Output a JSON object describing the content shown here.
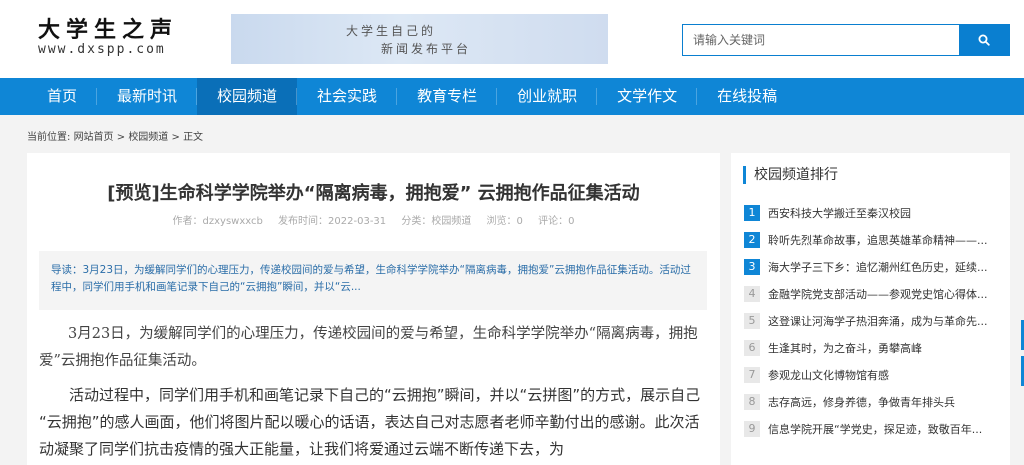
{
  "site": {
    "logo_cn": "大学生之声",
    "logo_en": "www.dxspp.com",
    "banner_line1": "大学生自己的",
    "banner_line2": "新闻发布平台"
  },
  "search": {
    "placeholder": "请输入关键词",
    "icon": "search-icon"
  },
  "nav": {
    "items": [
      {
        "label": "首页"
      },
      {
        "label": "最新时讯"
      },
      {
        "label": "校园频道",
        "active": true
      },
      {
        "label": "社会实践"
      },
      {
        "label": "教育专栏"
      },
      {
        "label": "创业就职"
      },
      {
        "label": "文学作文"
      },
      {
        "label": "在线投稿"
      }
    ]
  },
  "breadcrumb": {
    "prefix": "当前位置:",
    "home": "网站首页",
    "sep1": " > ",
    "channel": "校园频道",
    "sep2": " > ",
    "current": "正文"
  },
  "article": {
    "title": "[预览]生命科学学院举办“隔离病毒，拥抱爱” 云拥抱作品征集活动",
    "meta": {
      "author": "作者：dzxyswxxcb",
      "date": "发布时间：2022-03-31",
      "category": "分类：校园频道",
      "views": "浏览：0",
      "comments": "评论：0"
    },
    "summary": "导读：3月23日，为缓解同学们的心理压力，传递校园间的爱与希望，生命科学学院举办“隔离病毒，拥抱爱”云拥抱作品征集活动。活动过程中，同学们用手机和画笔记录下自己的“云拥抱”瞬间，并以“云...",
    "para1": "3月23日，为缓解同学们的心理压力，传递校园间的爱与希望，生命科学学院举办“隔离病毒，拥抱爱”云拥抱作品征集活动。",
    "para2": "活动过程中，同学们用手机和画笔记录下自己的“云拥抱”瞬间，并以“云拼图”的方式，展示自己 “云拥抱”的感人画面，他们将图片配以暖心的话语，表达自己对志愿者老师辛勤付出的感谢。此次活动凝聚了同学们抗击疫情的强大正能量，让我们将爱通过云端不断传递下去，为"
  },
  "sidebar": {
    "title": "校园频道排行",
    "items": [
      {
        "num": "1",
        "text": "西安科技大学搬迁至秦汉校园"
      },
      {
        "num": "2",
        "text": "聆听先烈革命故事，追思英雄革命精神——..."
      },
      {
        "num": "3",
        "text": "海大学子三下乡：追忆潮州红色历史，延续..."
      },
      {
        "num": "4",
        "text": "金融学院党支部活动——参观党史馆心得体..."
      },
      {
        "num": "5",
        "text": "这登课让河海学子热泪奔涌，成为与革命先..."
      },
      {
        "num": "6",
        "text": "生逢其时，为之奋斗，勇攀高峰"
      },
      {
        "num": "7",
        "text": "参观龙山文化博物馆有感"
      },
      {
        "num": "8",
        "text": "志存高远，修身养德，争做青年排头兵"
      },
      {
        "num": "9",
        "text": "信息学院开展“学党史，探足迹，致敬百年..."
      }
    ]
  },
  "colors": {
    "brand_blue": "#0f86d6",
    "nav_active": "#0a6fb8",
    "summary_text": "#2a6da8"
  }
}
